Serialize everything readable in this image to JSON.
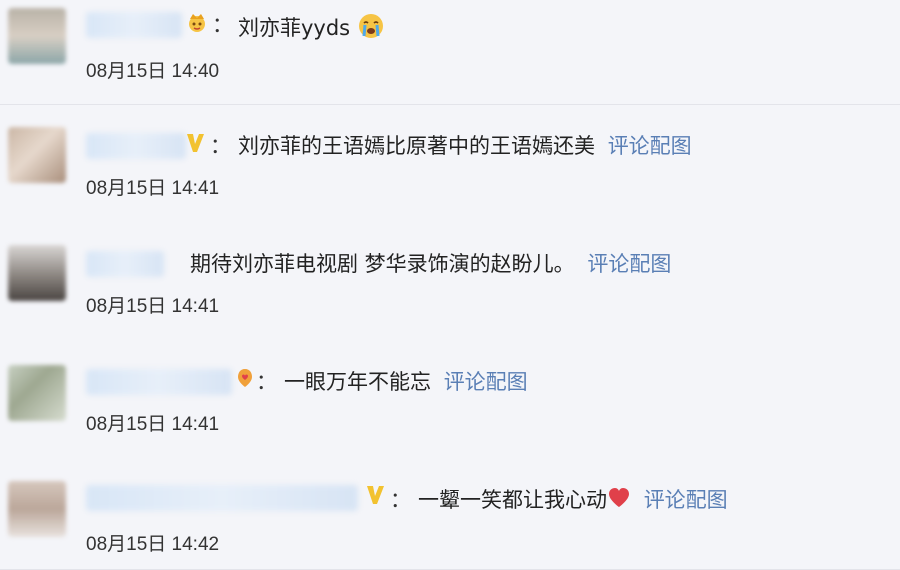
{
  "comments": [
    {
      "colon": "：",
      "text": "刘亦菲yyds",
      "link": "",
      "time": "08月15日 14:40",
      "badge": "crown-icon",
      "extra": "crying-emoji"
    },
    {
      "colon": "：",
      "text": "刘亦菲的王语嫣比原著中的王语嫣还美",
      "link": "评论配图",
      "time": "08月15日 14:41",
      "badge": "verified-v-icon",
      "extra": ""
    },
    {
      "colon": "",
      "text": "期待刘亦菲电视剧 梦华录饰演的赵盼儿。",
      "link": "评论配图",
      "time": "08月15日 14:41",
      "badge": "",
      "extra": ""
    },
    {
      "colon": "：",
      "text": "一眼万年不能忘",
      "link": "评论配图",
      "time": "08月15日 14:41",
      "badge": "heart-badge-icon",
      "extra": ""
    },
    {
      "colon": "：",
      "text": "一颦一笑都让我心动",
      "link": "评论配图",
      "time": "08月15日 14:42",
      "badge": "verified-v-icon",
      "extra": "red-heart-emoji"
    }
  ],
  "colors": {
    "link": "#5a7fb5",
    "badge_gold": "#f2c230",
    "heart": "#e0404a"
  }
}
